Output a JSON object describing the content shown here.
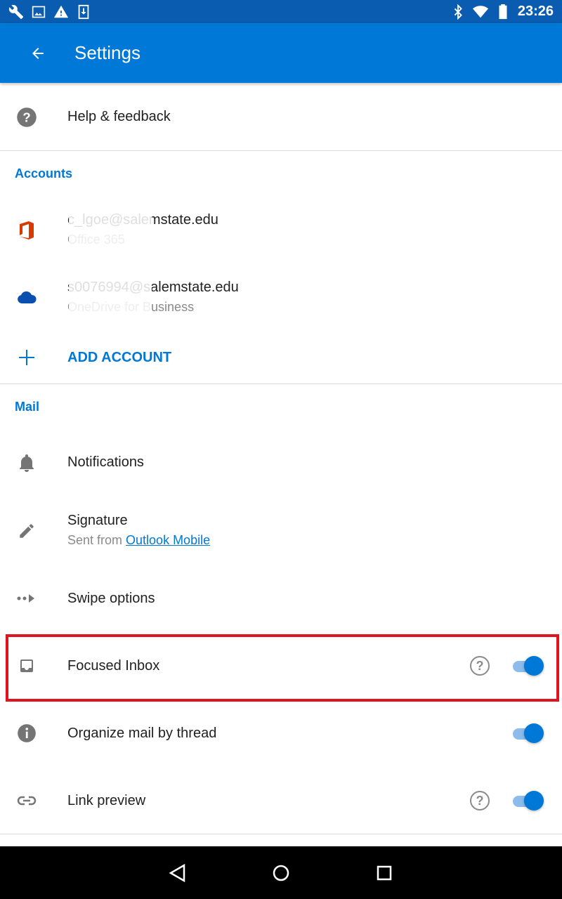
{
  "status_bar": {
    "time": "23:26",
    "left_icons": [
      "wrench-icon",
      "image-icon",
      "warning-icon",
      "download-icon"
    ],
    "right_icons": [
      "bluetooth-icon",
      "wifi-icon",
      "battery-icon"
    ]
  },
  "app_bar": {
    "title": "Settings"
  },
  "help": {
    "label": "Help & feedback"
  },
  "accounts": {
    "header": "Accounts",
    "items": [
      {
        "email": "c_lgoe@salemstate.edu",
        "type": "Office 365"
      },
      {
        "email": "s0076994@salemstate.edu",
        "type": "OneDrive for Business"
      }
    ],
    "add_label": "ADD ACCOUNT"
  },
  "mail": {
    "header": "Mail",
    "notifications": "Notifications",
    "signature": {
      "label": "Signature",
      "prefix": "Sent from ",
      "link": "Outlook Mobile"
    },
    "swipe": "Swipe options",
    "focused_inbox": {
      "label": "Focused Inbox",
      "enabled": true
    },
    "organize_thread": {
      "label": "Organize mail by thread",
      "enabled": true
    },
    "link_preview": {
      "label": "Link preview",
      "enabled": true
    }
  },
  "colors": {
    "accent": "#0078d7",
    "status_bar": "#0a5cb0",
    "highlight": "#e0141e",
    "office_red": "#d83b01"
  }
}
